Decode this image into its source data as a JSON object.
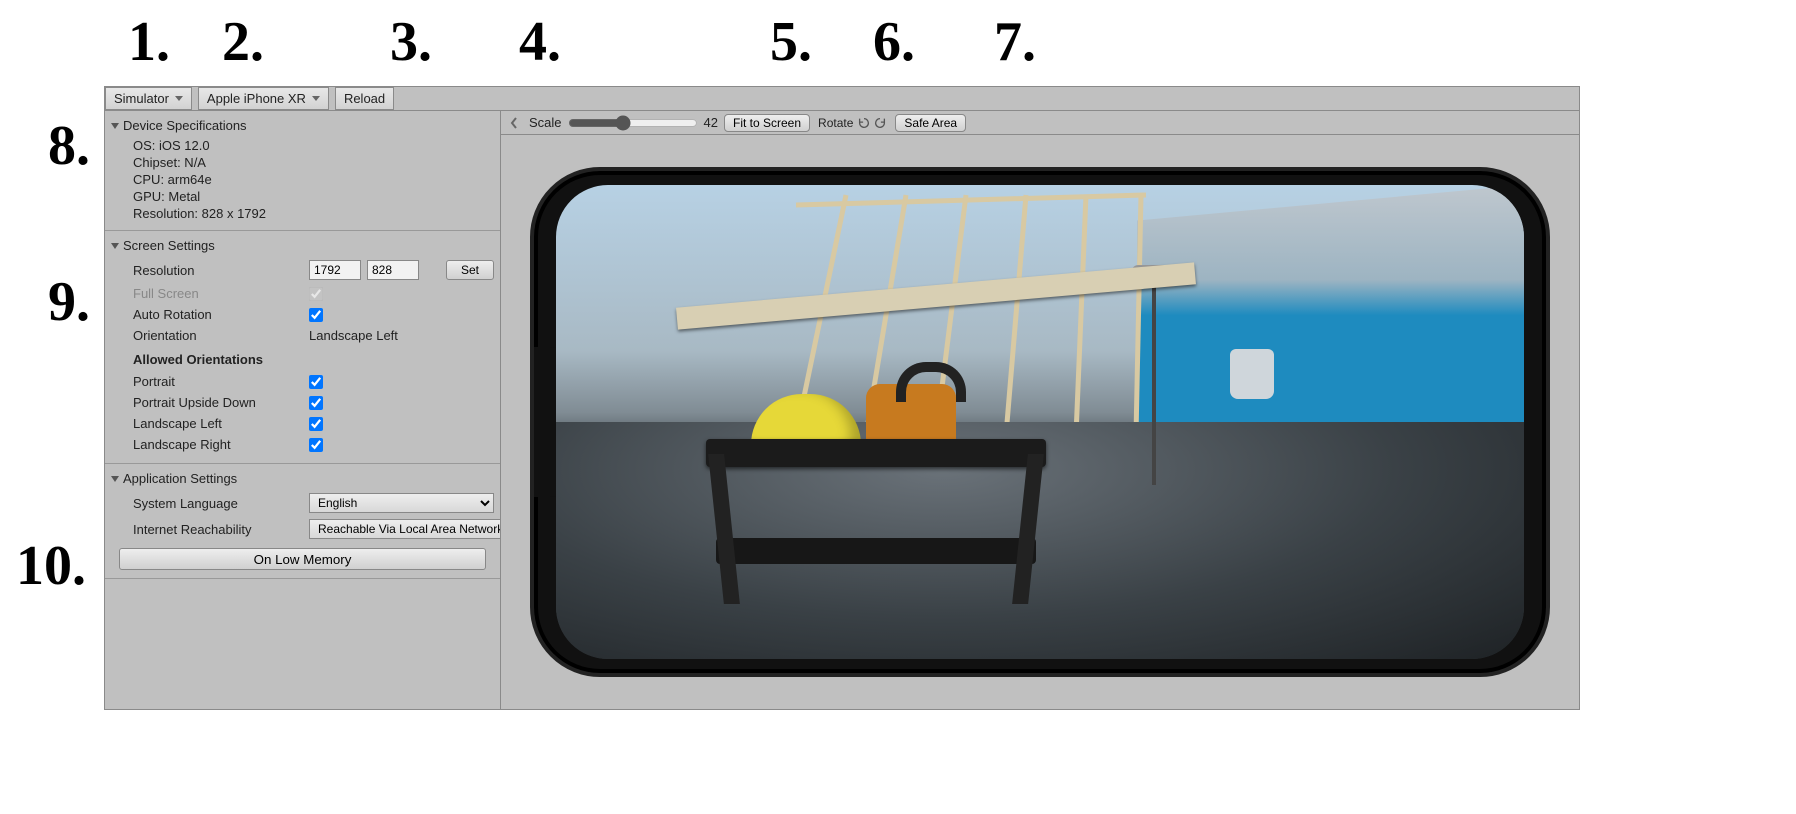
{
  "callouts": {
    "n1": "1.",
    "n2": "2.",
    "n3": "3.",
    "n4": "4.",
    "n5": "5.",
    "n6": "6.",
    "n7": "7.",
    "n8": "8.",
    "n9": "9.",
    "n10": "10."
  },
  "toolbar": {
    "mode": "Simulator",
    "device": "Apple iPhone XR",
    "reload": "Reload"
  },
  "deviceSpecs": {
    "header": "Device Specifications",
    "os": "OS: iOS 12.0",
    "chipset": "Chipset: N/A",
    "cpu": "CPU: arm64e",
    "gpu": "GPU: Metal",
    "resolution": "Resolution: 828 x 1792"
  },
  "screenSettings": {
    "header": "Screen Settings",
    "resolutionLabel": "Resolution",
    "resW": "1792",
    "resH": "828",
    "setBtn": "Set",
    "fullScreenLabel": "Full Screen",
    "fullScreenChecked": true,
    "autoRotationLabel": "Auto Rotation",
    "autoRotationChecked": true,
    "orientationLabel": "Orientation",
    "orientationValue": "Landscape Left",
    "allowedHeader": "Allowed Orientations",
    "portraitLabel": "Portrait",
    "portraitChecked": true,
    "portraitUDLabel": "Portrait Upside Down",
    "portraitUDChecked": true,
    "landscapeLeftLabel": "Landscape Left",
    "landscapeLeftChecked": true,
    "landscapeRightLabel": "Landscape Right",
    "landscapeRightChecked": true
  },
  "appSettings": {
    "header": "Application Settings",
    "sysLangLabel": "System Language",
    "sysLangValue": "English",
    "reachLabel": "Internet Reachability",
    "reachValue": "Reachable Via Local Area Network",
    "lowMemBtn": "On Low Memory"
  },
  "previewToolbar": {
    "scaleLabel": "Scale",
    "scaleValue": "42",
    "fitBtn": "Fit to Screen",
    "rotateLabel": "Rotate",
    "safeAreaBtn": "Safe Area"
  }
}
